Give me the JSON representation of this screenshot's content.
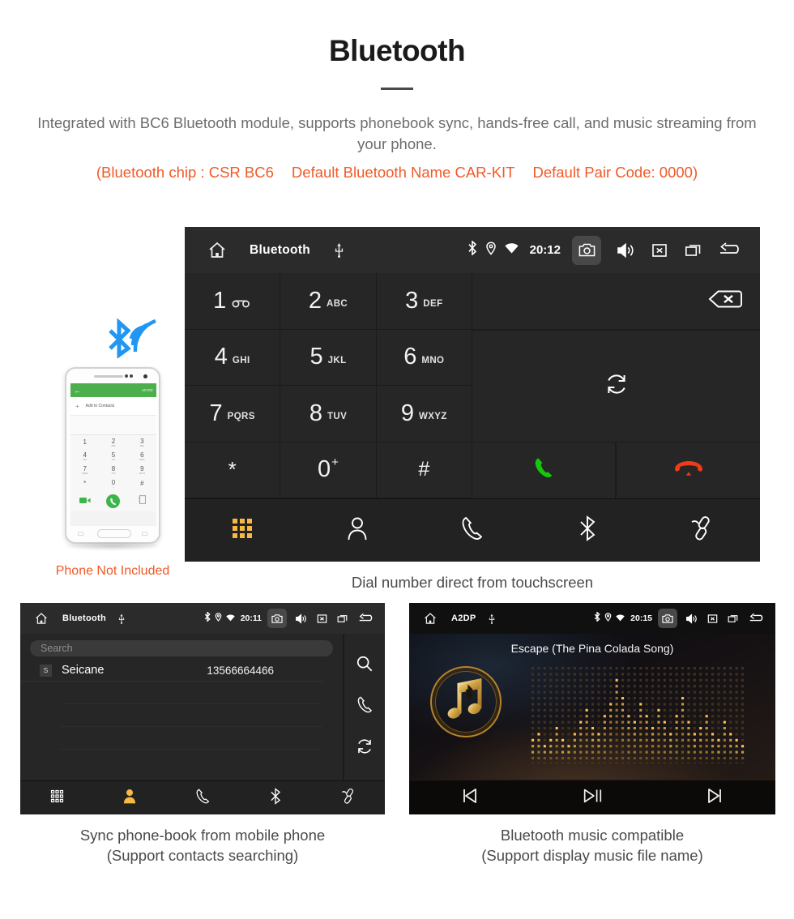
{
  "header": {
    "title": "Bluetooth",
    "description": "Integrated with BC6 Bluetooth module, supports phonebook sync, hands-free call, and music streaming from your phone.",
    "spec_chip": "(Bluetooth chip : CSR BC6",
    "spec_name": "Default Bluetooth Name CAR-KIT",
    "spec_pair": "Default Pair Code: 0000)"
  },
  "colors": {
    "accent_orange": "#f05a28",
    "tab_active": "#f5b944",
    "call_green": "#16c50d",
    "end_red": "#ef3b16",
    "panel_dark": "#1b1b1b",
    "key_dark": "#262626",
    "gold": "#b5832f"
  },
  "dialer": {
    "statusbar": {
      "title": "Bluetooth",
      "time": "20:12",
      "icons": [
        "home-icon",
        "usb-icon",
        "bluetooth-icon",
        "location-icon",
        "wifi-icon",
        "camera-icon",
        "volume-icon",
        "close-icon",
        "recents-icon",
        "back-icon"
      ]
    },
    "keys": [
      {
        "digit": "1",
        "letters": "",
        "voicemail": true
      },
      {
        "digit": "2",
        "letters": "ABC"
      },
      {
        "digit": "3",
        "letters": "DEF"
      },
      {
        "digit": "4",
        "letters": "GHI"
      },
      {
        "digit": "5",
        "letters": "JKL"
      },
      {
        "digit": "6",
        "letters": "MNO"
      },
      {
        "digit": "7",
        "letters": "PQRS"
      },
      {
        "digit": "8",
        "letters": "TUV"
      },
      {
        "digit": "9",
        "letters": "WXYZ"
      },
      {
        "digit": "*",
        "letters": ""
      },
      {
        "digit": "0",
        "letters": "",
        "sup": "+"
      },
      {
        "digit": "#",
        "letters": ""
      }
    ],
    "side_actions": [
      "backspace-icon",
      "sync-icon",
      "call-icon",
      "end-call-icon"
    ],
    "tabs": [
      {
        "name": "keypad",
        "icon": "keypad-icon",
        "active": true
      },
      {
        "name": "contacts",
        "icon": "person-icon",
        "active": false
      },
      {
        "name": "call-log",
        "icon": "phone-icon",
        "active": false
      },
      {
        "name": "bluetooth",
        "icon": "bluetooth-icon",
        "active": false
      },
      {
        "name": "pair",
        "icon": "link-icon",
        "active": false
      }
    ],
    "caption": "Dial number direct from touchscreen"
  },
  "phone_mockup": {
    "app_bar_more": "MORE",
    "add_to_contacts": "Add to Contacts",
    "keys": [
      {
        "digit": "1",
        "letters": ""
      },
      {
        "digit": "2",
        "letters": "ABC"
      },
      {
        "digit": "3",
        "letters": "DEF"
      },
      {
        "digit": "4",
        "letters": "GHI"
      },
      {
        "digit": "5",
        "letters": "JKL"
      },
      {
        "digit": "6",
        "letters": "MNO"
      },
      {
        "digit": "7",
        "letters": "PQRS"
      },
      {
        "digit": "8",
        "letters": "TUV"
      },
      {
        "digit": "9",
        "letters": "WXYZ"
      },
      {
        "digit": "*",
        "letters": ""
      },
      {
        "digit": "0",
        "letters": "+"
      },
      {
        "digit": "#",
        "letters": ""
      }
    ],
    "disclaimer": "Phone Not Included"
  },
  "phonebook": {
    "statusbar": {
      "title": "Bluetooth",
      "time": "20:11"
    },
    "search_placeholder": "Search",
    "contacts": [
      {
        "index": "S",
        "name": "Seicane",
        "number": "13566664466"
      }
    ],
    "side_actions": [
      "search-icon",
      "phone-icon",
      "sync-icon"
    ],
    "tabs": [
      {
        "name": "keypad",
        "icon": "keypad-icon",
        "active": false
      },
      {
        "name": "contacts",
        "icon": "person-icon",
        "active": true
      },
      {
        "name": "call-log",
        "icon": "phone-icon",
        "active": false
      },
      {
        "name": "bluetooth",
        "icon": "bluetooth-icon",
        "active": false
      },
      {
        "name": "pair",
        "icon": "link-icon",
        "active": false
      }
    ],
    "caption_line1": "Sync phone-book from mobile phone",
    "caption_line2": "(Support contacts searching)"
  },
  "music": {
    "statusbar": {
      "title": "A2DP",
      "time": "20:15"
    },
    "track_title": "Escape (The Pina Colada Song)",
    "controls": [
      "previous-icon",
      "play-pause-icon",
      "next-icon"
    ],
    "caption_line1": "Bluetooth music compatible",
    "caption_line2": "(Support display music file name)"
  }
}
